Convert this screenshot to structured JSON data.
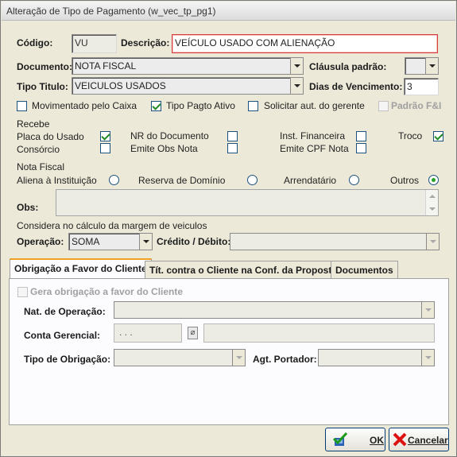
{
  "window": {
    "title": "Alteração de Tipo de Pagamento (w_vec_tp_pg1)"
  },
  "form": {
    "codigo_label": "Código:",
    "codigo_value": "VU",
    "descricao_label": "Descrição:",
    "descricao_value": "VEÍCULO USADO COM ALIENAÇÃO",
    "documento_label": "Documento:",
    "documento_value": "NOTA FISCAL",
    "clausula_label": "Cláusula padrão:",
    "clausula_value": "",
    "tipo_titulo_label": "Tipo Titulo:",
    "tipo_titulo_value": "VEICULOS USADOS",
    "dias_label": "Dias de Vencimento:",
    "dias_value": "3"
  },
  "options": [
    {
      "label": "Movimentado pelo Caixa",
      "checked": false,
      "enabled": true
    },
    {
      "label": "Tipo Pagto Ativo",
      "checked": true,
      "enabled": true
    },
    {
      "label": "Solicitar aut. do gerente",
      "checked": false,
      "enabled": true
    },
    {
      "label": "Padrão F&I",
      "checked": false,
      "enabled": false
    }
  ],
  "recebe": {
    "title": "Recebe",
    "items": [
      {
        "label": "Placa do Usado",
        "checked": true
      },
      {
        "label": "NR do Documento",
        "checked": false
      },
      {
        "label": "Inst. Financeira",
        "checked": false
      },
      {
        "label": "Troco",
        "checked": true
      },
      {
        "label": "Consórcio",
        "checked": false
      },
      {
        "label": "Emite Obs Nota",
        "checked": false
      },
      {
        "label": "Emite CPF Nota",
        "checked": false
      }
    ]
  },
  "nota_fiscal": {
    "title": "Nota Fiscal",
    "radios": [
      {
        "label": "Aliena à Instituição",
        "selected": false
      },
      {
        "label": "Reserva de Domínio",
        "selected": false
      },
      {
        "label": "Arrendatário",
        "selected": false
      },
      {
        "label": "Outros",
        "selected": true
      }
    ],
    "obs_label": "Obs:",
    "obs_value": ""
  },
  "margem": {
    "title": "Considera no cálculo da margem de veiculos",
    "operacao_label": "Operação:",
    "operacao_value": "SOMA",
    "credito_label": "Crédito / Débito:",
    "credito_value": ""
  },
  "tabs": [
    {
      "label": "Obrigação a Favor do Cliente",
      "active": true
    },
    {
      "label": "Tít. contra o Cliente na Conf. da Proposta",
      "active": false
    },
    {
      "label": "Documentos",
      "active": false
    }
  ],
  "obrigacao": {
    "gera_label": "Gera obrigação a favor do Cliente",
    "nat_label": "Nat. de Operação:",
    "nat_value": "",
    "conta_label": "Conta Gerencial:",
    "conta_mask": ". . .",
    "conta_desc": "",
    "tipo_label": "Tipo de Obrigação:",
    "tipo_value": "",
    "agt_label": "Agt. Portador:",
    "agt_value": ""
  },
  "buttons": {
    "ok": "OK",
    "cancel": "Cancelar"
  },
  "colors": {
    "accent_tab": "#f0a020",
    "required_border": "#d43b3b",
    "check_green": "#218a21"
  }
}
